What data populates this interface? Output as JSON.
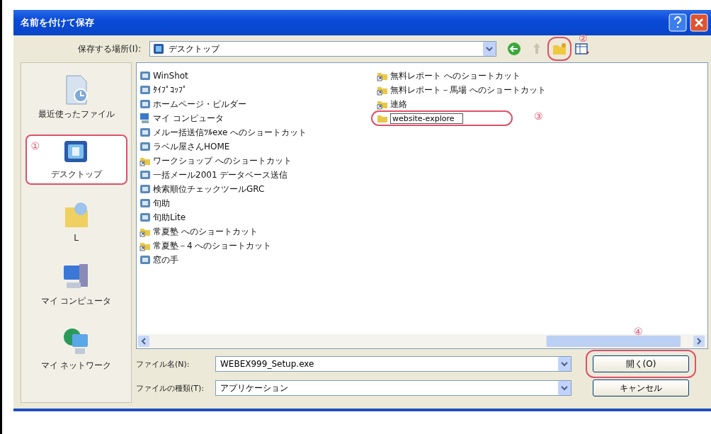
{
  "window": {
    "title": "名前を付けて保存"
  },
  "save_in": {
    "label": "保存する場所(I):",
    "value": "デスクトップ"
  },
  "toolbar": {
    "new_folder_marker": "②"
  },
  "places": [
    {
      "label": "最近使ったファイル",
      "kind": "recent",
      "selected": false
    },
    {
      "label": "デスクトップ",
      "kind": "desktop",
      "selected": true,
      "marker": "①"
    },
    {
      "label": "L",
      "kind": "documents",
      "selected": false
    },
    {
      "label": "マイ コンピュータ",
      "kind": "computer",
      "selected": false
    },
    {
      "label": "マイ ネットワーク",
      "kind": "network",
      "selected": false
    }
  ],
  "files": [
    {
      "name": "WinShot",
      "kind": "app"
    },
    {
      "name": "ﾀｲﾌﾟｺｯﾌﾟ",
      "kind": "app"
    },
    {
      "name": "ホームページ・ビルダー",
      "kind": "app"
    },
    {
      "name": "マイ コンピュータ",
      "kind": "computer"
    },
    {
      "name": "メルー括送信ﾂﾙexe へのショートカット",
      "kind": "app"
    },
    {
      "name": "ラベル屋さんHOME",
      "kind": "app"
    },
    {
      "name": "ワークショップ へのショートカット",
      "kind": "shortcut"
    },
    {
      "name": "一括メール2001 データベース送信",
      "kind": "app"
    },
    {
      "name": "検索順位チェックツールGRC",
      "kind": "app"
    },
    {
      "name": "旬助",
      "kind": "app"
    },
    {
      "name": "旬助Lite",
      "kind": "app"
    },
    {
      "name": "常夏塾 へのショートカット",
      "kind": "shortcut"
    },
    {
      "name": "常夏塾－4 へのショートカット",
      "kind": "shortcut"
    },
    {
      "name": "窓の手",
      "kind": "app"
    },
    {
      "name": "無料レポート へのショートカット",
      "kind": "shortcut"
    },
    {
      "name": "無料レポート－馬場 へのショートカット",
      "kind": "shortcut"
    },
    {
      "name": "連絡",
      "kind": "shortcut"
    },
    {
      "name": "website-explore",
      "kind": "rename",
      "marker": "③"
    }
  ],
  "file_name": {
    "label": "ファイル名(N):",
    "value": "WEBEX999_Setup.exe"
  },
  "file_type": {
    "label": "ファイルの種類(T):",
    "value": "アプリケーション"
  },
  "buttons": [
    {
      "label": "開く(O)",
      "marker": "④"
    },
    {
      "label": "キャンセル"
    }
  ]
}
